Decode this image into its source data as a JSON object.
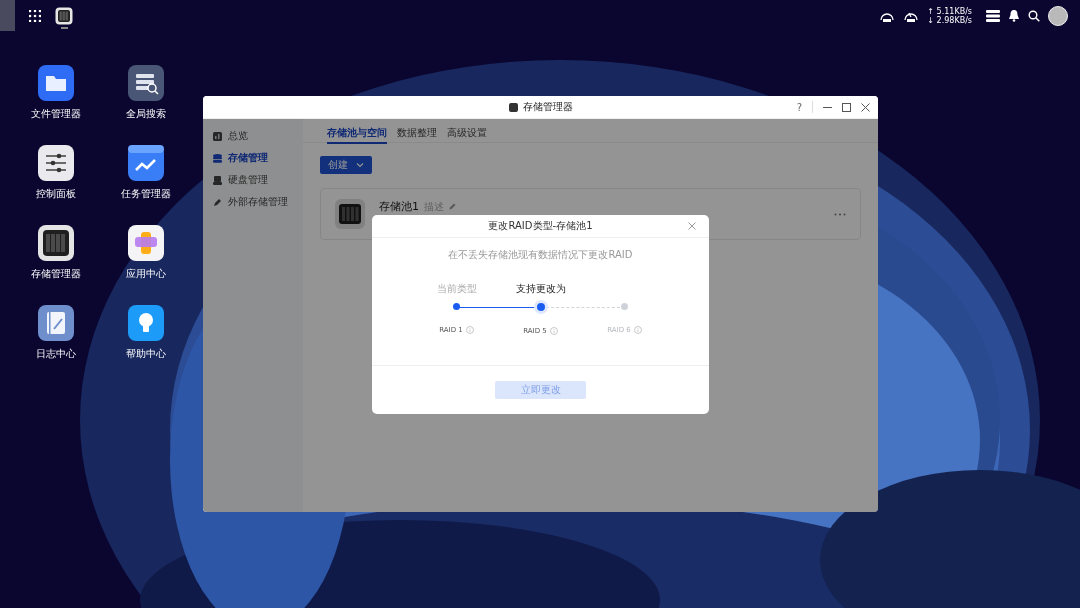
{
  "taskbar": {
    "apps": [
      {
        "kind": "storage",
        "running": true
      }
    ],
    "network": {
      "up": "↑ 5.11KB/s",
      "down": "↓ 2.98KB/s"
    }
  },
  "desktop": {
    "icons": [
      {
        "name": "文件管理器",
        "kind": "folder"
      },
      {
        "name": "全局搜索",
        "kind": "search"
      },
      {
        "name": "控制面板",
        "kind": "sliders"
      },
      {
        "name": "任务管理器",
        "kind": "chart"
      },
      {
        "name": "存储管理器",
        "kind": "storage"
      },
      {
        "name": "应用中心",
        "kind": "apps"
      },
      {
        "name": "日志中心",
        "kind": "log"
      },
      {
        "name": "帮助中心",
        "kind": "bulb"
      }
    ]
  },
  "window": {
    "title": "存储管理器",
    "help": "?",
    "sidebar": {
      "items": [
        {
          "label": "总览",
          "kind": "overview",
          "selected": false
        },
        {
          "label": "存储管理",
          "kind": "database",
          "selected": true
        },
        {
          "label": "硬盘管理",
          "kind": "disk",
          "selected": false
        },
        {
          "label": "外部存储管理",
          "kind": "external",
          "selected": false
        }
      ]
    },
    "tabs": [
      {
        "label": "存储池与空间",
        "selected": true
      },
      {
        "label": "数据整理",
        "selected": false
      },
      {
        "label": "高级设置",
        "selected": false
      }
    ],
    "create_button": "创建",
    "pool": {
      "name": "存储池1",
      "description": "描述"
    }
  },
  "dialog": {
    "title": "更改RAID类型-存储池1",
    "description": "在不丢失存储池现有数据情况下更改RAID",
    "steps": [
      {
        "caption": "当前类型",
        "label": "RAID 1",
        "reached": true,
        "selected": false
      },
      {
        "caption": "支持更改为",
        "label": "RAID 5",
        "reached": true,
        "selected": true
      },
      {
        "label": "RAID 6",
        "reached": false,
        "selected": false
      }
    ],
    "button": {
      "label": "立即更改",
      "disabled": true
    }
  }
}
